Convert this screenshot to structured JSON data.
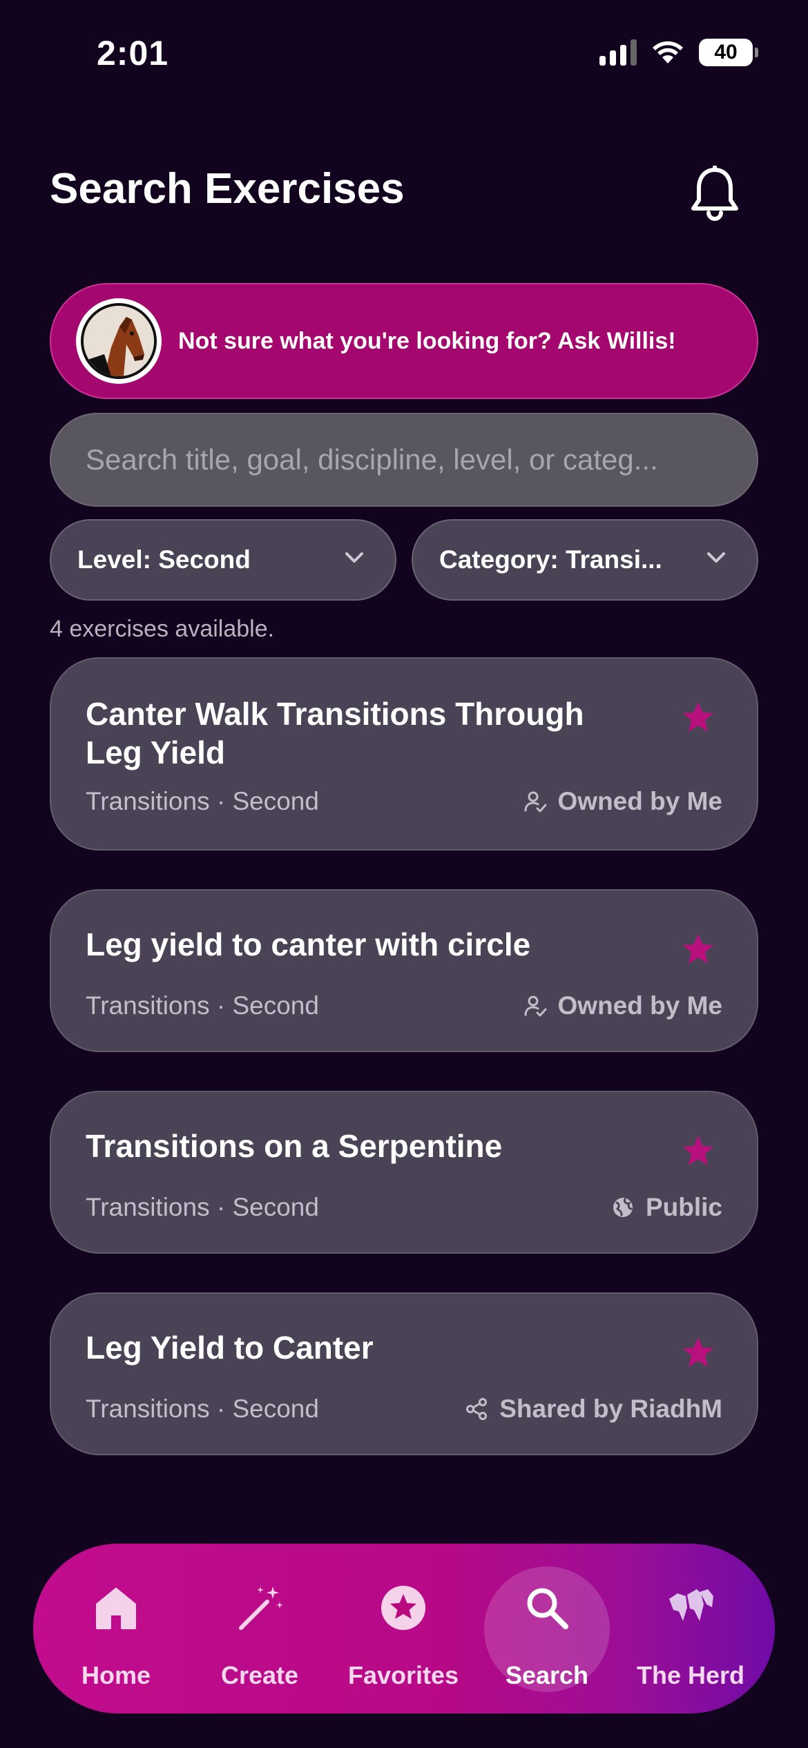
{
  "status_bar": {
    "time": "2:01",
    "battery": "40"
  },
  "header": {
    "title": "Search Exercises",
    "notification_icon": "bell-icon"
  },
  "willis_banner": {
    "text": "Not sure what you're looking for? Ask Willis!",
    "avatar_icon": "horse-avatar-icon"
  },
  "search": {
    "placeholder": "Search title, goal, discipline, level, or categ..."
  },
  "filters": {
    "level": "Level: Second",
    "category": "Category: Transi..."
  },
  "results_count": "4 exercises available.",
  "exercises": [
    {
      "title": "Canter Walk Transitions Through Leg Yield",
      "meta": "Transitions · Second",
      "owner": "Owned by Me",
      "owner_icon": "person-check-icon",
      "favorite": true
    },
    {
      "title": "Leg yield to canter with circle",
      "meta": "Transitions · Second",
      "owner": "Owned by Me",
      "owner_icon": "person-check-icon",
      "favorite": true
    },
    {
      "title": "Transitions on a Serpentine",
      "meta": "Transitions · Second",
      "owner": "Public",
      "owner_icon": "globe-icon",
      "favorite": true
    },
    {
      "title": "Leg Yield to Canter",
      "meta": "Transitions · Second",
      "owner": "Shared by RiadhM",
      "owner_icon": "share-icon",
      "favorite": true
    }
  ],
  "nav": [
    {
      "label": "Home",
      "icon": "home-icon"
    },
    {
      "label": "Create",
      "icon": "magic-wand-icon"
    },
    {
      "label": "Favorites",
      "icon": "star-circle-icon"
    },
    {
      "label": "Search",
      "icon": "search-icon",
      "active": true
    },
    {
      "label": "The Herd",
      "icon": "horses-icon"
    }
  ],
  "colors": {
    "background": "#12041f",
    "accent": "#a4076d",
    "card": "#4a4356",
    "star": "#b8117e"
  }
}
